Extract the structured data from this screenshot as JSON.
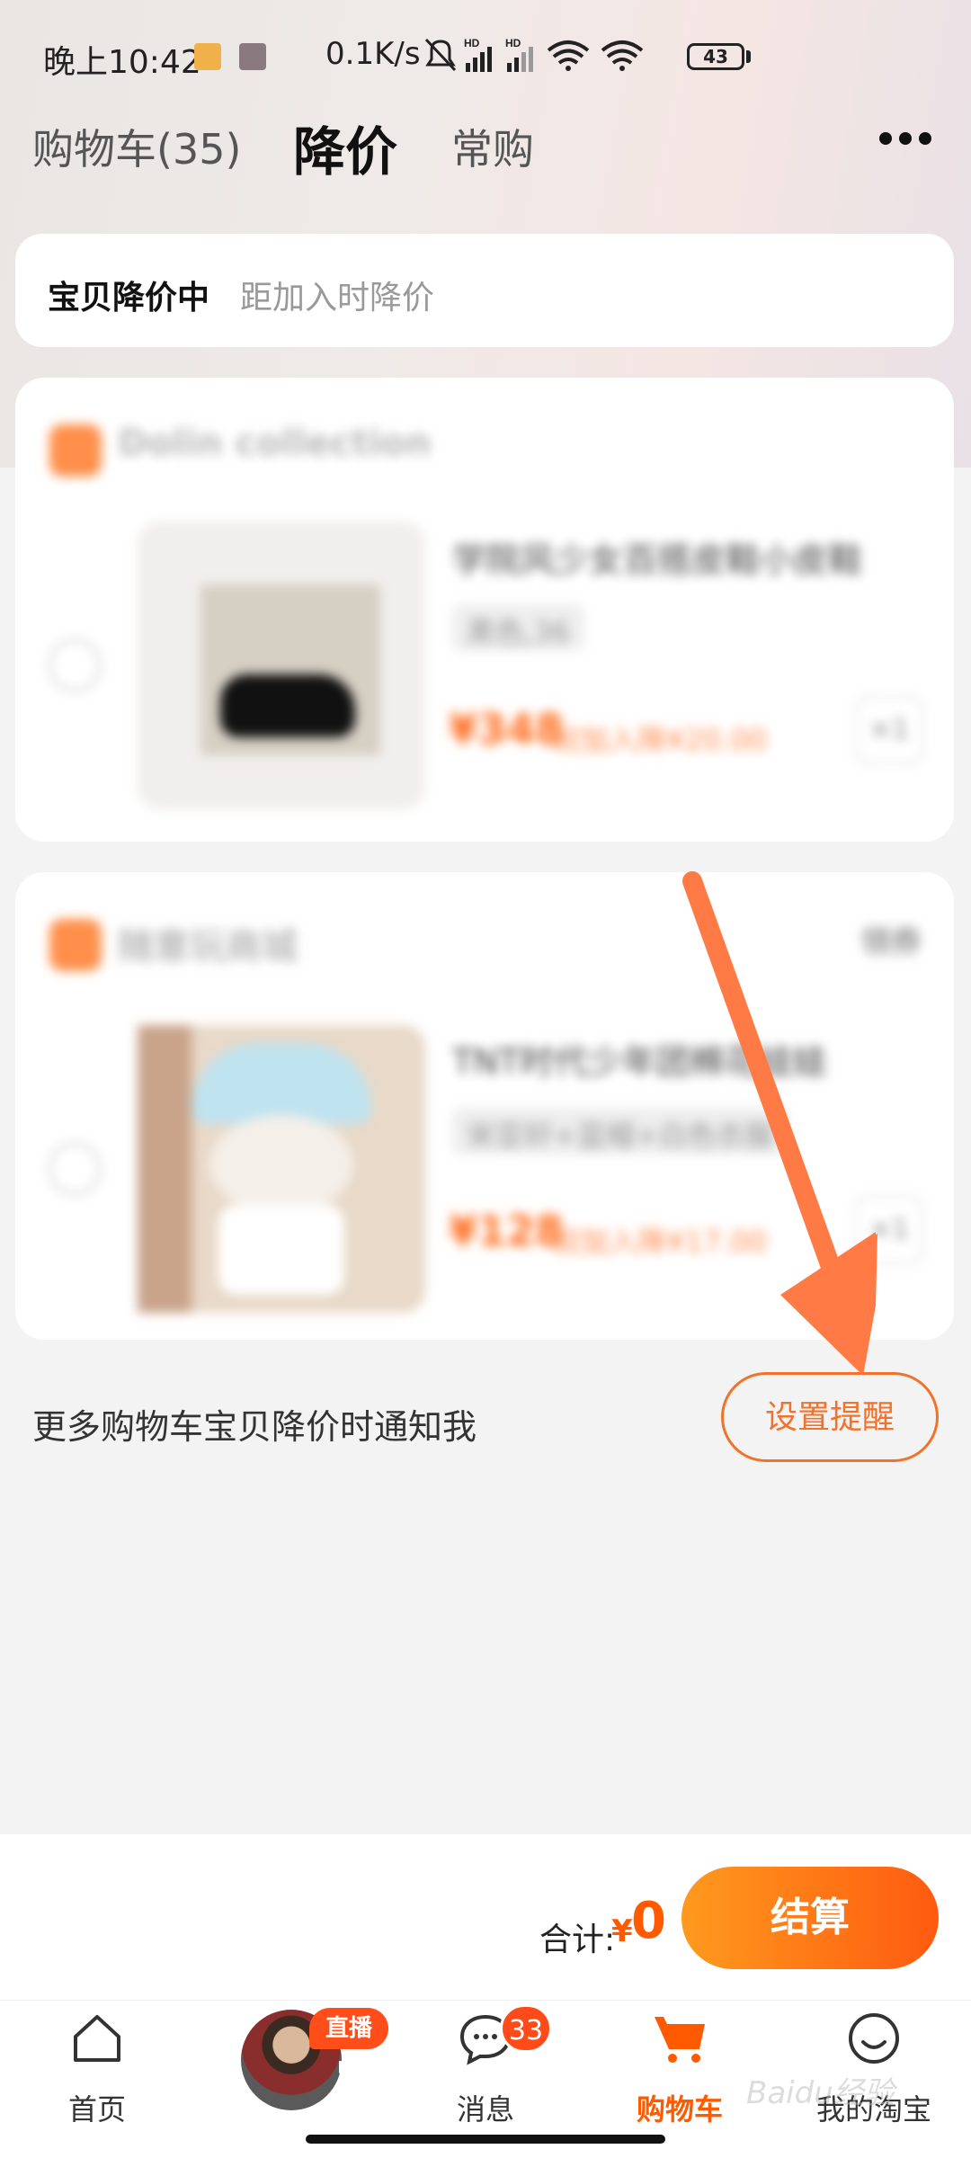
{
  "status_bar": {
    "time": "晚上10:42",
    "net_speed": "0.1K/s",
    "battery": "43",
    "icons": [
      "mute-icon",
      "signal-icon",
      "signal-icon",
      "wifi-icon",
      "wifi-icon",
      "battery-icon"
    ]
  },
  "tabs": [
    {
      "label": "购物车(35)",
      "active": false
    },
    {
      "label": "降价",
      "active": true
    },
    {
      "label": "常购",
      "active": false
    }
  ],
  "price_drop_banner": {
    "title": "宝贝降价中",
    "subtitle": "距加入时降价"
  },
  "shops": [
    {
      "name": "Dolin collection",
      "product": {
        "title": "学院风少女百搭皮鞋小皮鞋",
        "sku": "黑色,36",
        "price": "¥348",
        "note": "较加入降¥20.00",
        "qty": "×1"
      }
    },
    {
      "name": "随意玩商城",
      "action": "领券",
      "product": {
        "title": "TNT时代少年团棉花娃娃",
        "sku": "宋亚轩+蓝帽+白色衣服",
        "price": "¥128",
        "note": "较加入降¥17.00",
        "qty": "×1"
      }
    }
  ],
  "notify": {
    "text": "更多购物车宝贝降价时通知我",
    "button": "设置提醒"
  },
  "checkout": {
    "total_label": "合计:",
    "currency": "¥",
    "amount": "0",
    "button": "结算"
  },
  "bottom_nav": [
    {
      "label": "首页",
      "icon": "home-icon"
    },
    {
      "label": "",
      "icon": "live-avatar",
      "badge": "直播中"
    },
    {
      "label": "消息",
      "icon": "message-icon",
      "badge": "33"
    },
    {
      "label": "购物车",
      "icon": "cart-icon",
      "active": true
    },
    {
      "label": "我的淘宝",
      "icon": "profile-icon"
    }
  ],
  "colors": {
    "accent": "#ff5a00",
    "remind_border": "#f2722b",
    "arrow": "#ff7a45"
  },
  "watermark": "Baidu经验 jingyan.baidu.com"
}
